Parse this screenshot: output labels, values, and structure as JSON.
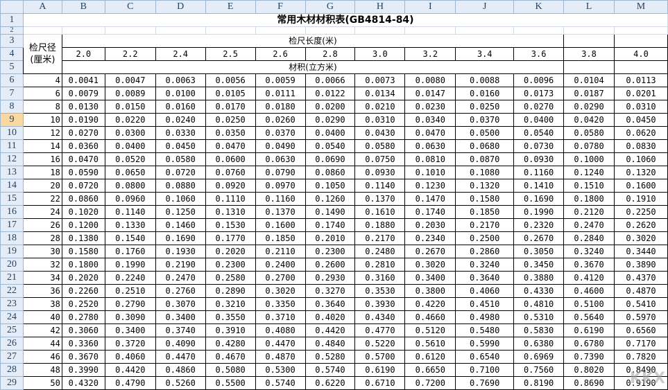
{
  "columns": [
    "A",
    "B",
    "C",
    "D",
    "E",
    "F",
    "G",
    "H",
    "I",
    "J",
    "K",
    "L",
    "M"
  ],
  "selected_row": 9,
  "title": "常用木材材积表(GB4814-84)",
  "diameter_label": "检尺径(厘米)",
  "length_label": "检尺长度(米)",
  "volume_label": "材积(立方米)",
  "lengths": [
    "2.0",
    "2.2",
    "2.4",
    "2.5",
    "2.6",
    "2.8",
    "3.0",
    "3.2",
    "3.4",
    "3.6",
    "3.8",
    "4.0"
  ],
  "rows": [
    {
      "d": "4",
      "v": [
        "0.0041",
        "0.0047",
        "0.0063",
        "0.0056",
        "0.0059",
        "0.0066",
        "0.0073",
        "0.0080",
        "0.0088",
        "0.0096",
        "0.0104",
        "0.0113"
      ]
    },
    {
      "d": "6",
      "v": [
        "0.0079",
        "0.0089",
        "0.0100",
        "0.0105",
        "0.0111",
        "0.0122",
        "0.0134",
        "0.0147",
        "0.0160",
        "0.0173",
        "0.0187",
        "0.0201"
      ]
    },
    {
      "d": "8",
      "v": [
        "0.0130",
        "0.0150",
        "0.0160",
        "0.0170",
        "0.0180",
        "0.0200",
        "0.0210",
        "0.0230",
        "0.0250",
        "0.0270",
        "0.0290",
        "0.0310"
      ]
    },
    {
      "d": "10",
      "v": [
        "0.0190",
        "0.0220",
        "0.0240",
        "0.0250",
        "0.0260",
        "0.0290",
        "0.0310",
        "0.0340",
        "0.0370",
        "0.0400",
        "0.0420",
        "0.0450"
      ]
    },
    {
      "d": "12",
      "v": [
        "0.0270",
        "0.0300",
        "0.0330",
        "0.0350",
        "0.0370",
        "0.0400",
        "0.0430",
        "0.0470",
        "0.0500",
        "0.0540",
        "0.0580",
        "0.0620"
      ]
    },
    {
      "d": "14",
      "v": [
        "0.0360",
        "0.0400",
        "0.0450",
        "0.0470",
        "0.0490",
        "0.0540",
        "0.0580",
        "0.0630",
        "0.0680",
        "0.0730",
        "0.0780",
        "0.0830"
      ]
    },
    {
      "d": "16",
      "v": [
        "0.0470",
        "0.0520",
        "0.0580",
        "0.0600",
        "0.0630",
        "0.0690",
        "0.0750",
        "0.0810",
        "0.0870",
        "0.0930",
        "0.1000",
        "0.1060"
      ]
    },
    {
      "d": "18",
      "v": [
        "0.0590",
        "0.0650",
        "0.0720",
        "0.0760",
        "0.0790",
        "0.0860",
        "0.0930",
        "0.1010",
        "0.1080",
        "0.1160",
        "0.1240",
        "0.1320"
      ]
    },
    {
      "d": "20",
      "v": [
        "0.0720",
        "0.0800",
        "0.0880",
        "0.0920",
        "0.0970",
        "0.1050",
        "0.1140",
        "0.1230",
        "0.1320",
        "0.1410",
        "0.1510",
        "0.1600"
      ]
    },
    {
      "d": "22",
      "v": [
        "0.0860",
        "0.0960",
        "0.1060",
        "0.1110",
        "0.1160",
        "0.1260",
        "0.1370",
        "0.1470",
        "0.1580",
        "0.1690",
        "0.1800",
        "0.1910"
      ]
    },
    {
      "d": "24",
      "v": [
        "0.1020",
        "0.1140",
        "0.1250",
        "0.1310",
        "0.1370",
        "0.1490",
        "0.1610",
        "0.1740",
        "0.1850",
        "0.1990",
        "0.2120",
        "0.2250"
      ]
    },
    {
      "d": "26",
      "v": [
        "0.1200",
        "0.1330",
        "0.1460",
        "0.1530",
        "0.1600",
        "0.1740",
        "0.1880",
        "0.2030",
        "0.2170",
        "0.2320",
        "0.2470",
        "0.2620"
      ]
    },
    {
      "d": "28",
      "v": [
        "0.1380",
        "0.1540",
        "0.1690",
        "0.1770",
        "0.1850",
        "0.2010",
        "0.2170",
        "0.2340",
        "0.2500",
        "0.2670",
        "0.2840",
        "0.3020"
      ]
    },
    {
      "d": "30",
      "v": [
        "0.1580",
        "0.1760",
        "0.1930",
        "0.2020",
        "0.2110",
        "0.2300",
        "0.2480",
        "0.2670",
        "0.2860",
        "0.3050",
        "0.3240",
        "0.3440"
      ]
    },
    {
      "d": "32",
      "v": [
        "0.1800",
        "0.1990",
        "0.2190",
        "0.2300",
        "0.2400",
        "0.2600",
        "0.2810",
        "0.3020",
        "0.3240",
        "0.3450",
        "0.3670",
        "0.3890"
      ]
    },
    {
      "d": "34",
      "v": [
        "0.2020",
        "0.2240",
        "0.2470",
        "0.2580",
        "0.2700",
        "0.2930",
        "0.3160",
        "0.3400",
        "0.3640",
        "0.3880",
        "0.4120",
        "0.4370"
      ]
    },
    {
      "d": "36",
      "v": [
        "0.2260",
        "0.2510",
        "0.2760",
        "0.2890",
        "0.3020",
        "0.3270",
        "0.3530",
        "0.3800",
        "0.4060",
        "0.4330",
        "0.4600",
        "0.4870"
      ]
    },
    {
      "d": "38",
      "v": [
        "0.2520",
        "0.2790",
        "0.3070",
        "0.3210",
        "0.3350",
        "0.3640",
        "0.3930",
        "0.4220",
        "0.4510",
        "0.4810",
        "0.5100",
        "0.5410"
      ]
    },
    {
      "d": "40",
      "v": [
        "0.2780",
        "0.3090",
        "0.3400",
        "0.3550",
        "0.3710",
        "0.4020",
        "0.4340",
        "0.4660",
        "0.4980",
        "0.5310",
        "0.5640",
        "0.5970"
      ]
    },
    {
      "d": "42",
      "v": [
        "0.3060",
        "0.3400",
        "0.3740",
        "0.3910",
        "0.4080",
        "0.4420",
        "0.4770",
        "0.5120",
        "0.5480",
        "0.5830",
        "0.6190",
        "0.6560"
      ]
    },
    {
      "d": "44",
      "v": [
        "0.3360",
        "0.3720",
        "0.4090",
        "0.4280",
        "0.4470",
        "0.4840",
        "0.5220",
        "0.5610",
        "0.5990",
        "0.6380",
        "0.6780",
        "0.7170"
      ]
    },
    {
      "d": "46",
      "v": [
        "0.3670",
        "0.4060",
        "0.4470",
        "0.4670",
        "0.4870",
        "0.5280",
        "0.5700",
        "0.6120",
        "0.6540",
        "0.6969",
        "0.7390",
        "0.7820"
      ]
    },
    {
      "d": "48",
      "v": [
        "0.3990",
        "0.4420",
        "0.4860",
        "0.5080",
        "0.5300",
        "0.5740",
        "0.6190",
        "0.6650",
        "0.7100",
        "0.7560",
        "0.8020",
        "0.8490"
      ]
    },
    {
      "d": "50",
      "v": [
        "0.4320",
        "0.4790",
        "0.5260",
        "0.5500",
        "0.5740",
        "0.6220",
        "0.6710",
        "0.7200",
        "0.7690",
        "0.8190",
        "0.8690",
        "0.9190"
      ]
    }
  ]
}
